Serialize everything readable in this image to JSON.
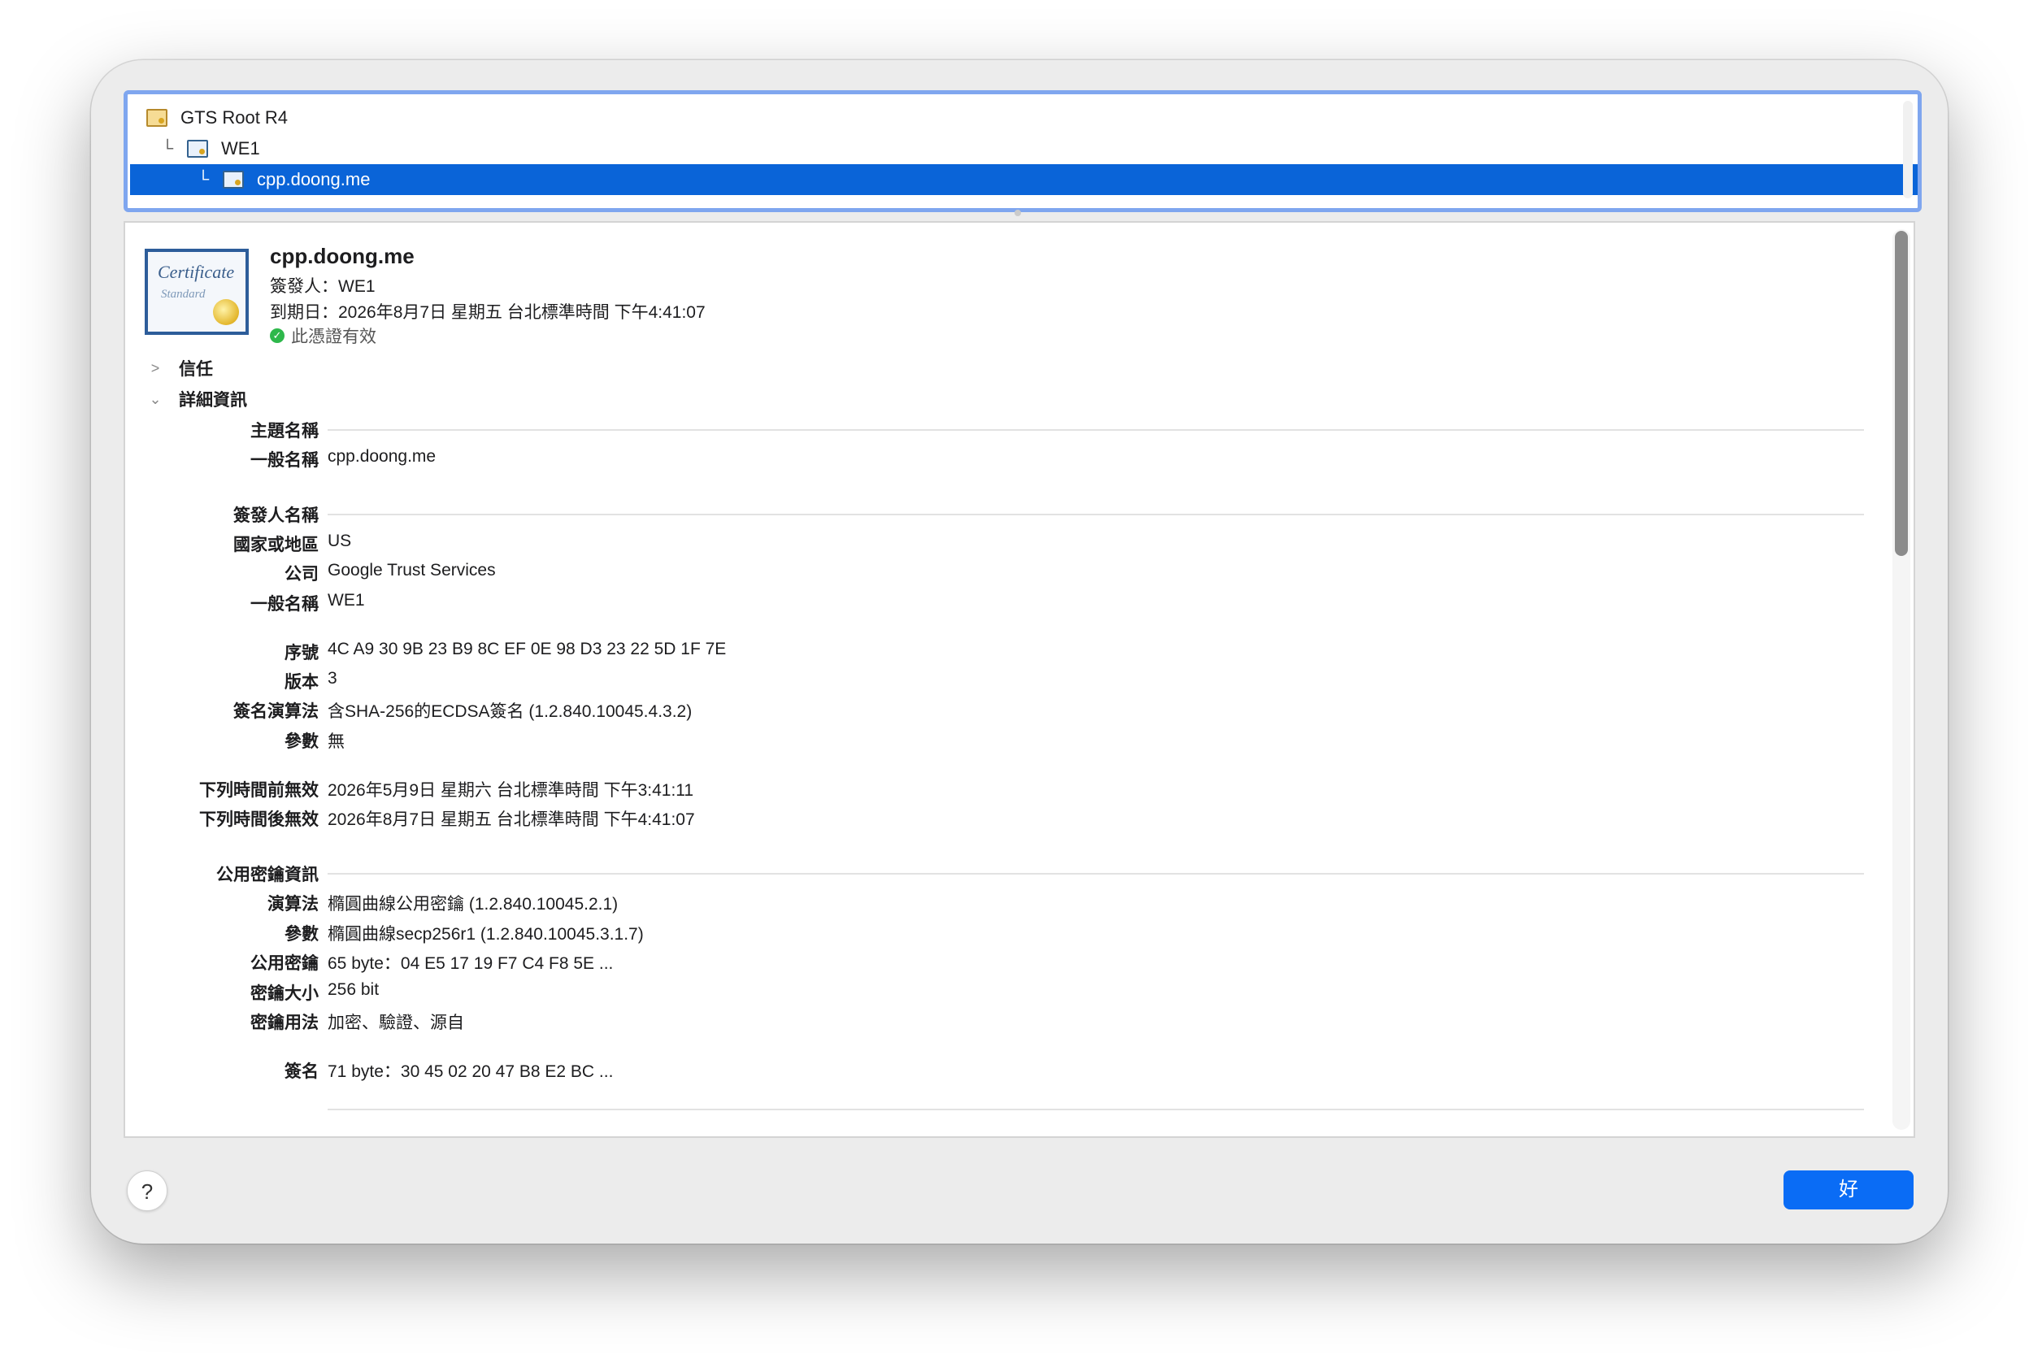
{
  "tree": {
    "items": [
      {
        "label": "GTS Root R4",
        "level": 0,
        "selected": false
      },
      {
        "label": "WE1",
        "level": 1,
        "selected": false
      },
      {
        "label": "cpp.doong.me",
        "level": 2,
        "selected": true
      }
    ]
  },
  "header": {
    "cert_title": "cpp.doong.me",
    "issuer_line": "簽發人：WE1",
    "expiry_line": "到期日：2026年8月7日 星期五 台北標準時間 下午4:41:07",
    "valid_text": "此憑證有效",
    "cert_image_text_1": "Certificate",
    "cert_image_text_2": "Standard"
  },
  "sections": {
    "trust": "信任",
    "details": "詳細資訊"
  },
  "details": {
    "subject_name": "主題名稱",
    "subject_common_name_label": "一般名稱",
    "subject_common_name": "cpp.doong.me",
    "issuer_name": "簽發人名稱",
    "country_label": "國家或地區",
    "country": "US",
    "org_label": "公司",
    "org": "Google Trust Services",
    "issuer_common_name_label": "一般名稱",
    "issuer_common_name": "WE1",
    "serial_label": "序號",
    "serial": "4C A9 30 9B 23 B9 8C EF 0E 98 D3 23 22 5D 1F 7E",
    "version_label": "版本",
    "version": "3",
    "sig_alg_label": "簽名演算法",
    "sig_alg": "含SHA-256的ECDSA簽名 (1.2.840.10045.4.3.2)",
    "params_label": "參數",
    "params": "無",
    "not_before_label": "下列時間前無效",
    "not_before": "2026年5月9日 星期六 台北標準時間 下午3:41:11",
    "not_after_label": "下列時間後無效",
    "not_after": "2026年8月7日 星期五 台北標準時間 下午4:41:07",
    "pubkey_info": "公用密鑰資訊",
    "pk_alg_label": "演算法",
    "pk_alg": "橢圓曲線公用密鑰 (1.2.840.10045.2.1)",
    "pk_params_label": "參數",
    "pk_params": "橢圓曲線secp256r1 (1.2.840.10045.3.1.7)",
    "pk_label": "公用密鑰",
    "pk": "65 byte：04 E5 17 19 F7 C4 F8 5E ...",
    "key_size_label": "密鑰大小",
    "key_size": "256 bit",
    "key_usage_label": "密鑰用法",
    "key_usage": "加密、驗證、源自",
    "signature_label": "簽名",
    "signature": "71 byte：30 45 02 20 47 B8 E2 BC ..."
  },
  "footer": {
    "help_label": "?",
    "ok_label": "好"
  },
  "colors": {
    "selection": "#0a64d8",
    "ok_button": "#0a6cf5",
    "valid_check": "#2eb84b",
    "tree_focus_ring": "#7fa6ef"
  }
}
